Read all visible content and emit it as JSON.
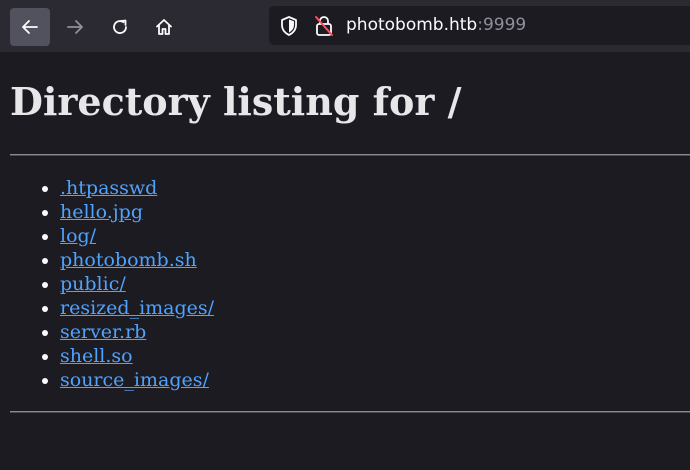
{
  "browser": {
    "back_icon": "arrow-left-icon",
    "forward_icon": "arrow-right-icon",
    "reload_icon": "reload-icon",
    "home_icon": "home-icon",
    "url_host": "photobomb.htb",
    "url_port": ":9999",
    "shield_icon": "shield-icon",
    "lock_icon": "insecure-lock-icon",
    "accent_color": "#ff4f5e"
  },
  "page": {
    "title": "Directory listing for /",
    "entries": [
      ".htpasswd",
      "hello.jpg",
      "log/",
      "photobomb.sh",
      "public/",
      "resized_images/",
      "server.rb",
      "shell.so",
      "source_images/"
    ],
    "link_color": "#4fa3ff"
  }
}
